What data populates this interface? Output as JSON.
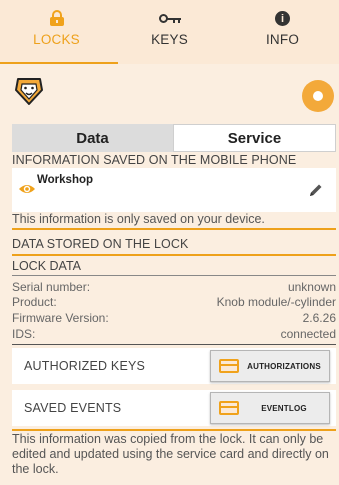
{
  "nav": {
    "tabs": [
      {
        "label": "LOCKS",
        "icon": "padlock-icon",
        "active": true
      },
      {
        "label": "KEYS",
        "icon": "key-icon",
        "active": false
      },
      {
        "label": "INFO",
        "icon": "info-icon",
        "active": false
      }
    ],
    "info_glyph": "i"
  },
  "segment": {
    "data_label": "Data",
    "service_label": "Service",
    "selected": "Service"
  },
  "mobile_section": {
    "title": "INFORMATION SAVED ON THE MOBILE PHONE",
    "entry_name": "Workshop",
    "note": "This information is only saved on your device."
  },
  "lock_section": {
    "title": "DATA STORED ON THE LOCK",
    "header": "LOCK DATA",
    "rows": [
      {
        "key": "Serial number:",
        "value": "unknown"
      },
      {
        "key": "Product:",
        "value": "Knob module/-cylinder"
      },
      {
        "key": "Firmware Version:",
        "value": "2.6.26"
      },
      {
        "key": "IDS:",
        "value": "connected"
      }
    ]
  },
  "actions": {
    "authorized_keys_label": "AUTHORIZED KEYS",
    "authorizations_button": "AUTHORIZATIONS",
    "saved_events_label": "SAVED EVENTS",
    "eventlog_button": "EVENTLOG"
  },
  "footer": {
    "text": "This information was copied from the lock. It can only be edited and updated using the service card and directly on the lock."
  },
  "colors": {
    "accent": "#eea11b",
    "background": "#fbeee0",
    "nav_bg": "#fbe9d6"
  }
}
